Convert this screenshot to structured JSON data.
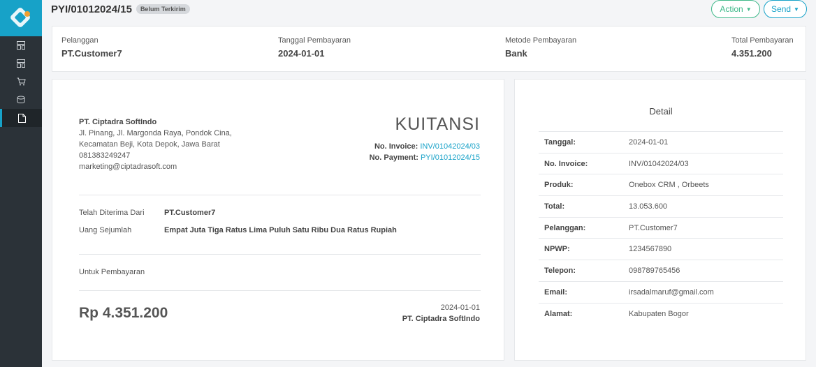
{
  "header": {
    "doc_number": "PYI/01012024/15",
    "status": "Belum Terkirim",
    "action_label": "Action",
    "send_label": "Send"
  },
  "sidebar": {
    "items": [
      {
        "icon": "dashboard-icon"
      },
      {
        "icon": "grid-icon"
      },
      {
        "icon": "cart-icon"
      },
      {
        "icon": "database-icon"
      },
      {
        "icon": "document-icon",
        "active": true
      }
    ]
  },
  "summary": {
    "customer_label": "Pelanggan",
    "customer_value": "PT.Customer7",
    "date_label": "Tanggal Pembayaran",
    "date_value": "2024-01-01",
    "method_label": "Metode Pembayaran",
    "method_value": "Bank",
    "total_label": "Total Pembayaran",
    "total_value": "4.351.200"
  },
  "receipt": {
    "company_name": "PT. Ciptadra SoftIndo",
    "address_1": "Jl. Pinang, Jl. Margonda Raya, Pondok Cina,",
    "address_2": "Kecamatan Beji, Kota Depok, Jawa Barat",
    "phone": "081383249247",
    "email": "marketing@ciptadrasoft.com",
    "title": "KUITANSI",
    "invoice_label": "No. Invoice:",
    "invoice_value": "INV/01042024/03",
    "payment_label": "No. Payment:",
    "payment_value": "PYI/01012024/15",
    "received_from_label": "Telah Diterima Dari",
    "received_from_value": "PT.Customer7",
    "amount_words_label": "Uang Sejumlah",
    "amount_words_value": "Empat Juta Tiga Ratus Lima Puluh Satu Ribu Dua Ratus Rupiah",
    "purpose_label": "Untuk Pembayaran",
    "amount": "Rp 4.351.200",
    "sign_date": "2024-01-01",
    "sign_name": "PT. Ciptadra SoftIndo"
  },
  "detail": {
    "title": "Detail",
    "rows": [
      {
        "label": "Tanggal:",
        "value": "2024-01-01"
      },
      {
        "label": "No. Invoice:",
        "value": "INV/01042024/03"
      },
      {
        "label": "Produk:",
        "value": "Onebox CRM , Orbeets"
      },
      {
        "label": "Total:",
        "value": "13.053.600"
      },
      {
        "label": "Pelanggan:",
        "value": "PT.Customer7"
      },
      {
        "label": "NPWP:",
        "value": "1234567890"
      },
      {
        "label": "Telepon:",
        "value": "098789765456"
      },
      {
        "label": "Email:",
        "value": "irsadalmaruf@gmail.com"
      },
      {
        "label": "Alamat:",
        "value": "Kabupaten Bogor"
      }
    ]
  }
}
